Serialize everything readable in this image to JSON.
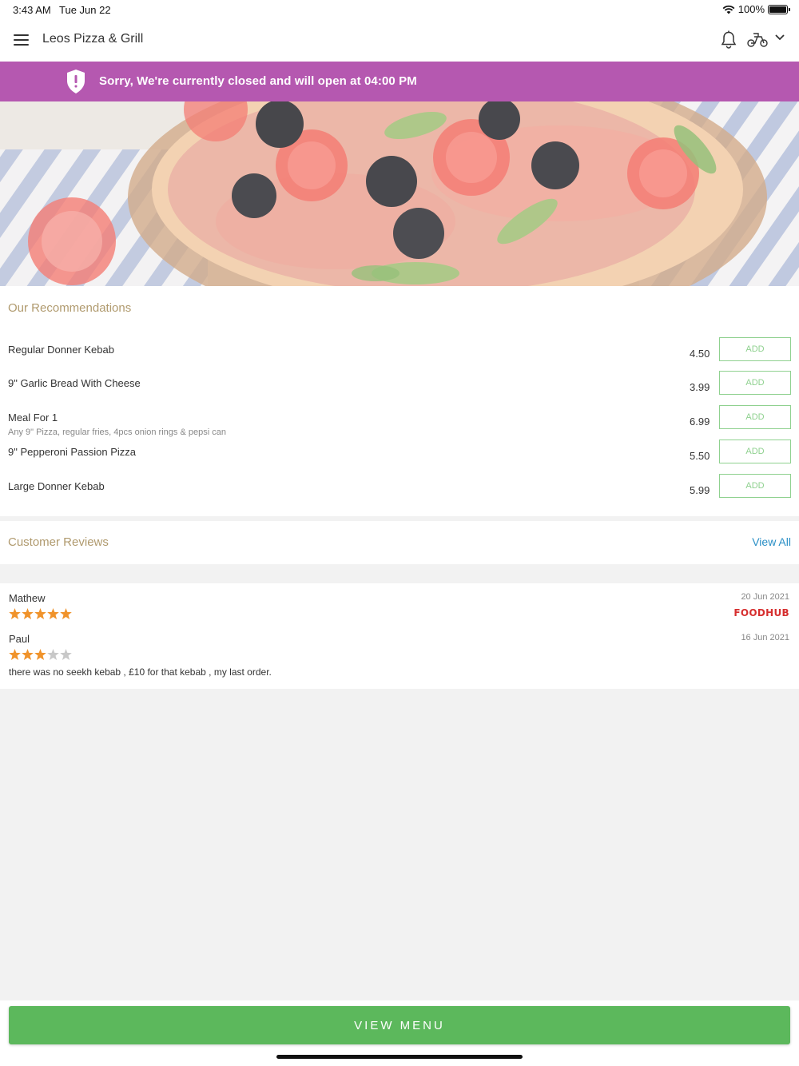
{
  "status_bar": {
    "time": "3:43 AM",
    "date": "Tue Jun 22",
    "battery": "100%"
  },
  "header": {
    "title": "Leos Pizza & Grill",
    "icons": [
      "menu-icon",
      "bell-icon",
      "scooter-icon",
      "chevron-down-icon"
    ]
  },
  "banner": {
    "text": "Sorry, We're currently closed and will open at 04:00 PM",
    "icon": "shield-alert-icon",
    "color": "#b558b0"
  },
  "recommendations": {
    "title": "Our Recommendations",
    "add_label": "ADD",
    "items": [
      {
        "name": "Regular Donner Kebab",
        "description": "",
        "price": "4.50"
      },
      {
        "name": "9\" Garlic Bread With Cheese",
        "description": "",
        "price": "3.99"
      },
      {
        "name": "Meal For 1",
        "description": "Any 9\" Pizza, regular fries, 4pcs onion rings & pepsi can",
        "price": "6.99"
      },
      {
        "name": "9\" Pepperoni Passion Pizza",
        "description": "",
        "price": "5.50"
      },
      {
        "name": "Large Donner Kebab",
        "description": "",
        "price": "5.99"
      }
    ]
  },
  "reviews": {
    "title": "Customer Reviews",
    "view_all": "View All",
    "items": [
      {
        "name": "Mathew",
        "rating": 5,
        "date": "20 Jun 2021",
        "source": "FOODHUB",
        "text": ""
      },
      {
        "name": "Paul",
        "rating": 3,
        "date": "16 Jun 2021",
        "source": "",
        "text": "there was no seekh kebab , £10 for that kebab , my last order."
      }
    ]
  },
  "footer": {
    "view_menu": "VIEW MENU"
  },
  "colors": {
    "accent_green": "#5cb85c",
    "star": "#f0932b",
    "section_title": "#b09a6e",
    "link": "#2a8fc6"
  }
}
